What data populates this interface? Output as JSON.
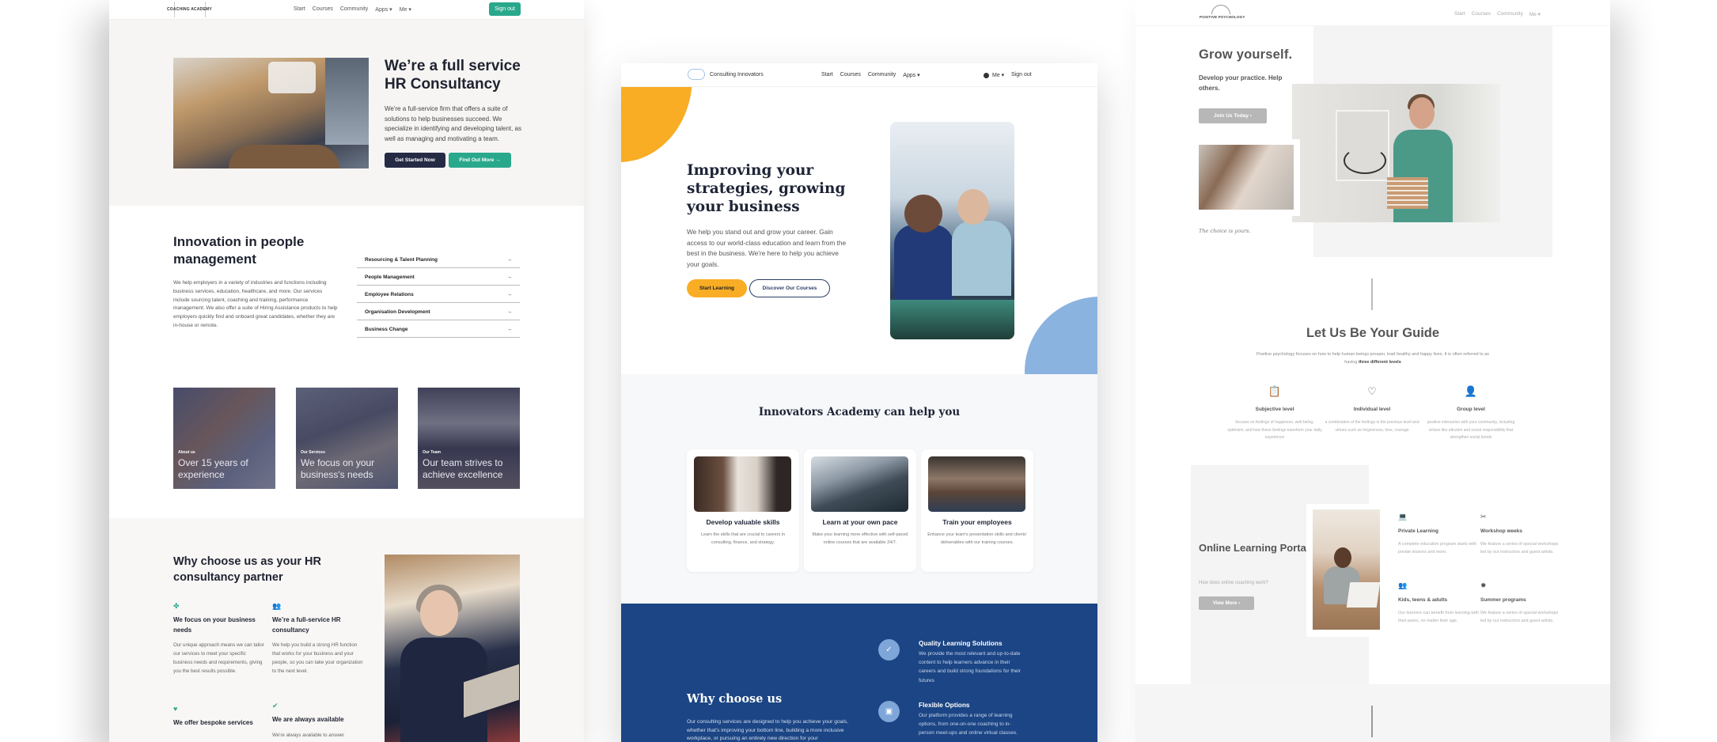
{
  "pages": {
    "coaching": {
      "nav": {
        "logo": "COACHING ACADEMY",
        "links": [
          "Start",
          "Courses",
          "Community",
          "Apps ▾",
          "Me ▾"
        ],
        "signout": "Sign out"
      },
      "hero": {
        "title": "We’re a full service HR Consultancy",
        "body": "We're a full-service firm that offers a suite of solutions to help businesses succeed. We specialize in identifying and developing talent, as well as managing and motivating a team.",
        "primary_btn": "Get Started Now",
        "secondary_btn": "Find Out More →"
      },
      "innovation": {
        "title": "Innovation in people management",
        "body": "We help employers in a variety of industries and functions including business services, education, healthcare, and more. Our services include sourcing talent, coaching and training, performance management. We also offer a suite of Hiring Assistance products to help employers quickly find and onboard great candidates, whether they are in-house or remote.",
        "services": [
          {
            "label": "Resourcing & Talent Planning",
            "arrow": "→"
          },
          {
            "label": "People Management",
            "arrow": "→"
          },
          {
            "label": "Employee Relations",
            "arrow": "→"
          },
          {
            "label": "Organisation Development",
            "arrow": "→"
          },
          {
            "label": "Business Change",
            "arrow": "→"
          }
        ]
      },
      "cards": [
        {
          "kicker": "About us",
          "title": "Over 15 years of experience"
        },
        {
          "kicker": "Our Services",
          "title": "We focus on your business's needs"
        },
        {
          "kicker": "Our Team",
          "title": "Our team strives to achieve excellence"
        }
      ],
      "why": {
        "title": "Why choose us as your HR consultancy partner",
        "features": [
          {
            "icon": "handshake-icon",
            "glyph": "✤",
            "title": "We focus on your business needs",
            "body": "Our unique approach means we can tailor our services to meet your specific business needs and requirements, giving you the best results possible."
          },
          {
            "icon": "group-icon",
            "glyph": "👥",
            "title": "We’re a full-service HR consultancy",
            "body": "We help you build a strong HR function that works for your business and your people, so you can take your organization to the next level."
          },
          {
            "icon": "hand-heart-icon",
            "glyph": "♥",
            "title": "We offer bespoke services",
            "body": ""
          },
          {
            "icon": "check-circle-icon",
            "glyph": "✔",
            "title": "We are always available",
            "body": "We're always available to answer"
          }
        ]
      },
      "accent": "#2aa88c",
      "dark": "#262b45"
    },
    "consulting": {
      "nav": {
        "logo": "Consulting Innovators",
        "links": [
          "Start",
          "Courses",
          "Community",
          "Apps ▾"
        ],
        "me": "Me ▾",
        "signout": "Sign out"
      },
      "hero": {
        "title": "Improving your strategies, growing your business",
        "body": "We help you stand out and grow your career. Gain access to our world-class education and learn from the best in the business. We're here to help you achieve your goals.",
        "primary_btn": "Start Learning",
        "secondary_btn": "Discover Our Courses"
      },
      "help": {
        "title": "Innovators Academy can help you",
        "cards": [
          {
            "title": "Develop valuable skills",
            "body": "Learn the skills that are crucial to careers in consulting, finance, and strategy."
          },
          {
            "title": "Learn at your own pace",
            "body": "Make your learning more effective with self-paced online courses that are available 24/7."
          },
          {
            "title": "Train your employees",
            "body": "Enhance your team's presentation skills and clients' deliverables with our training courses."
          }
        ]
      },
      "why": {
        "title": "Why choose us",
        "body": "Our consulting services are designed to help you achieve your goals, whether that's improving your bottom line, building a more inclusive workplace, or pursuing an entirely new direction for your",
        "features": [
          {
            "icon": "clipboard-check-icon",
            "glyph": "✓",
            "title": "Quality Learning Solutions",
            "body": "We provide the most relevant and up-to-date content to help learners advance in their careers and build strong foundations for their futures"
          },
          {
            "icon": "presentation-icon",
            "glyph": "▣",
            "title": "Flexible Options",
            "body": "Our platform provides a range of learning options, from one-on-one coaching to in-person meet-ups and online virtual classes."
          }
        ]
      },
      "accent_yellow": "#f8ad25",
      "accent_blue": "#1b4584",
      "light_blue": "#8bb3df"
    },
    "psychology": {
      "nav": {
        "logo": "POSITIVE PSYCHOLOGY",
        "links": [
          "Start",
          "Courses",
          "Community",
          "Me ▾"
        ]
      },
      "hero": {
        "title": "Grow yourself.",
        "subtitle": "Develop your practice. Help others.",
        "button": "Join Us Today ›",
        "tagline": "The choice is yours."
      },
      "guide": {
        "title": "Let Us Be Your Guide",
        "intro": "Positive psychology focuses on how to help human beings prosper, lead healthy and happy lives. It is often referred to as having",
        "intro_bold": "three different levels",
        "levels": [
          {
            "icon": "clipboard-icon",
            "glyph": "📋",
            "title": "Subjective level",
            "body": "focuses on feelings of happiness, well-being, optimism, and how these feelings transform your daily experience"
          },
          {
            "icon": "heart-icon",
            "glyph": "♡",
            "title": "Individual level",
            "body": "a combination of the feelings in the previous level and virtues such as forgiveness, love, courage"
          },
          {
            "icon": "user-icon",
            "glyph": "👤",
            "title": "Group level",
            "body": "positive interaction with your community, including virtues like altruism and social responsibility that strengthen social bonds"
          }
        ]
      },
      "portal": {
        "title": "Online Learning Portal",
        "question": "How does online coaching work?",
        "button": "View More ›",
        "features": [
          {
            "icon": "laptop-icon",
            "glyph": "💻",
            "title": "Private Learning",
            "body": "A complete education program starts with private lessons and more."
          },
          {
            "icon": "tools-icon",
            "glyph": "✂",
            "title": "Workshop weeks",
            "body": "We feature a series of special workshops led by our instructors and guest artists."
          },
          {
            "icon": "people-icon",
            "glyph": "👥",
            "title": "Kids, teens & adults",
            "body": "Our learners can benefit from learning with their peers, no matter their age."
          },
          {
            "icon": "sun-icon",
            "glyph": "✹",
            "title": "Summer programs",
            "body": "We feature a series of special workshops led by our instructors and guest artists."
          }
        ]
      }
    }
  }
}
